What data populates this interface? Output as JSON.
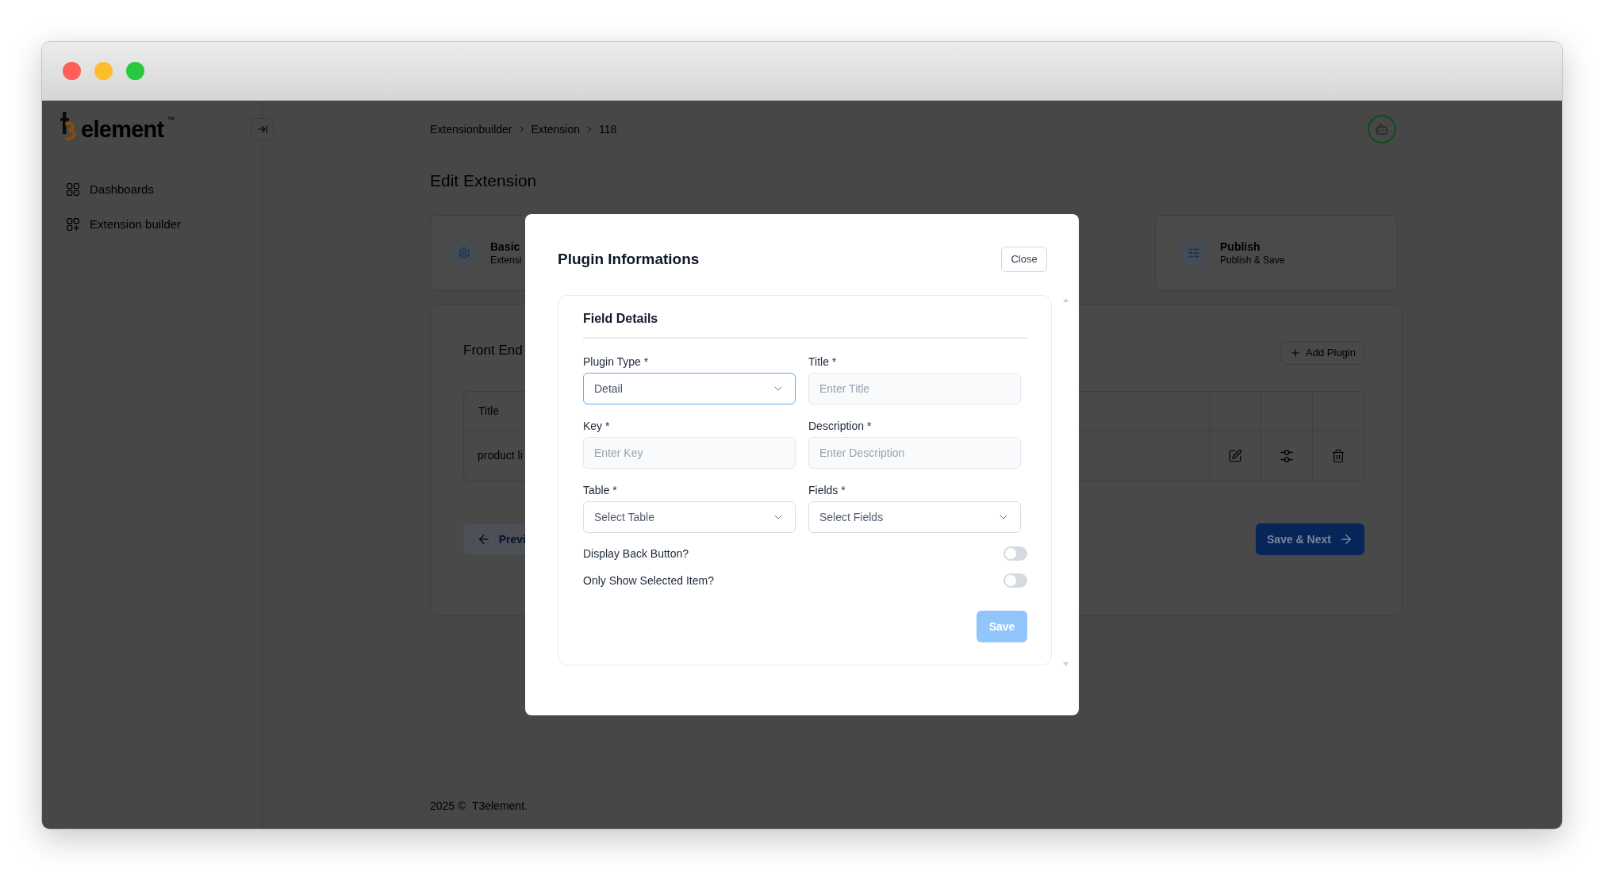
{
  "window": {
    "buttons": [
      {
        "color": "#fe5f57"
      },
      {
        "color": "#febc2e"
      },
      {
        "color": "#28c840"
      }
    ]
  },
  "sidebar": {
    "logo": {
      "name": "element",
      "trademark": "™"
    },
    "items": [
      {
        "kind": "dashboards",
        "label": "Dashboards",
        "selected": false
      },
      {
        "kind": "builder",
        "label": "Extension builder",
        "selected": false
      }
    ]
  },
  "header": {
    "breadcrumbs": [
      "Extensionbuilder",
      "Extension",
      "118"
    ]
  },
  "page": {
    "title": "Edit Extension"
  },
  "steps": [
    {
      "kind": "basic",
      "title": "Basic",
      "subtitle": "Extensi"
    },
    {
      "kind": "publish",
      "title": "Publish",
      "subtitle": "Publish & Save"
    }
  ],
  "section": {
    "title": "Front End",
    "add_button": "Add Plugin",
    "table": {
      "columns": [
        "Title"
      ],
      "rows": [
        {
          "cells": [
            "product li"
          ]
        }
      ]
    },
    "previous_button": "Previ",
    "next_button": "Save & Next"
  },
  "footer": {
    "text": "2025 ©  T3element."
  },
  "modal": {
    "title": "Plugin Informations",
    "close_button": "Close",
    "section_title": "Field Details",
    "fields": [
      {
        "kind": "select",
        "label": "Plugin Type *",
        "value": "Detail",
        "focused": true
      },
      {
        "kind": "text",
        "label": "Title *",
        "placeholder": "Enter Title",
        "focused": false
      },
      {
        "kind": "text",
        "label": "Key *",
        "placeholder": "Enter Key",
        "focused": false
      },
      {
        "kind": "text",
        "label": "Description *",
        "placeholder": "Enter Description",
        "focused": false
      },
      {
        "kind": "select",
        "label": "Table *",
        "placeholder": "Select Table",
        "focused": false
      },
      {
        "kind": "select",
        "label": "Fields *",
        "placeholder": "Select Fields",
        "focused": false
      }
    ],
    "switches": [
      {
        "label": "Display Back Button?",
        "on": false
      },
      {
        "label": "Only Show Selected Item?",
        "on": false
      }
    ],
    "save_button": {
      "label": "Save",
      "disabled": true
    }
  }
}
